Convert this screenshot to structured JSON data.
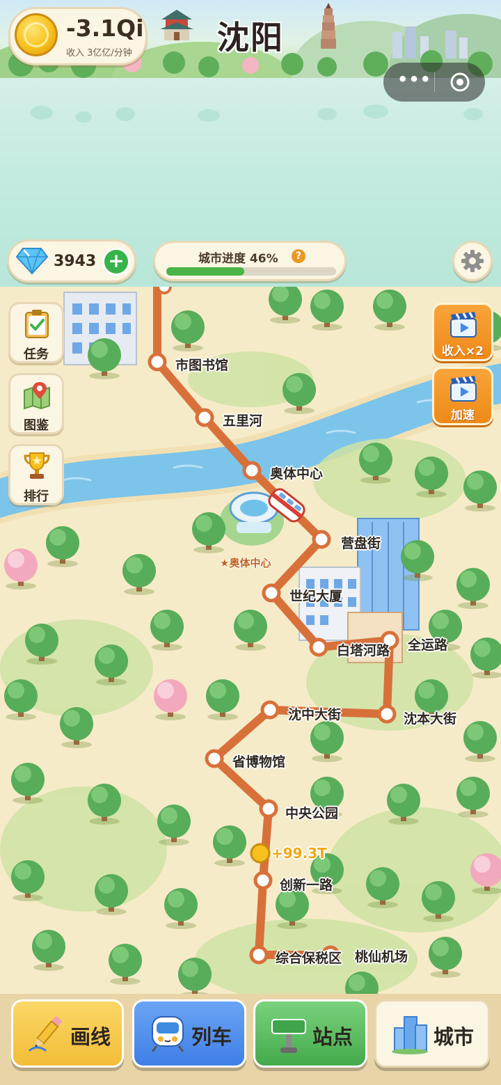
{
  "header": {
    "city_name": "沈阳",
    "coins": "-3.1Qi",
    "income_rate": "收入 3亿亿/分钟"
  },
  "capsule": {
    "more_icon": "more-dots-icon",
    "close_icon": "target-circle-icon"
  },
  "resources": {
    "gems": "3943",
    "progress_label": "城市进度 46%",
    "progress_value": 0.46
  },
  "side_menu": [
    {
      "label": "任务",
      "icon": "clipboard-check-icon"
    },
    {
      "label": "图鉴",
      "icon": "map-pin-icon"
    },
    {
      "label": "排行",
      "icon": "trophy-icon"
    }
  ],
  "boost_buttons": [
    {
      "label": "收入×2",
      "icon": "video-clapper-icon"
    },
    {
      "label": "加速",
      "icon": "video-clapper-icon"
    }
  ],
  "map": {
    "landmark_label": "★奥体中心",
    "income_popup": "+99.3T",
    "stations": [
      "市图书馆",
      "五里河",
      "奥体中心",
      "营盘街",
      "世纪大厦",
      "白塔河路",
      "全运路",
      "沈本大街",
      "沈中大街",
      "省博物馆",
      "中央公园",
      "创新一路",
      "综合保税区",
      "桃仙机场"
    ],
    "line_color": "#d8703a"
  },
  "bottom_nav": [
    {
      "label": "画线",
      "icon": "pencil-icon"
    },
    {
      "label": "列车",
      "icon": "train-icon"
    },
    {
      "label": "站点",
      "icon": "signpost-icon"
    },
    {
      "label": "城市",
      "icon": "buildings-icon"
    }
  ]
}
